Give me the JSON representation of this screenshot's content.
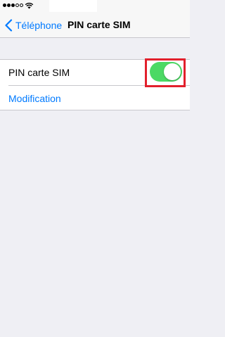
{
  "status_bar": {
    "signal_bars_filled": 3,
    "signal_bars_total": 5,
    "icons": [
      "signal-dots-icon",
      "wifi-icon"
    ]
  },
  "nav": {
    "back_label": "Téléphone",
    "back_icon": "chevron-left-icon",
    "title": "PIN carte SIM"
  },
  "settings": {
    "pin_row": {
      "label": "PIN carte SIM",
      "toggle_on": true
    },
    "modification_label": "Modification"
  },
  "colors": {
    "accent": "#007aff",
    "toggle_on": "#4cd964",
    "highlight_box": "#e2202c",
    "background": "#efeff4"
  }
}
